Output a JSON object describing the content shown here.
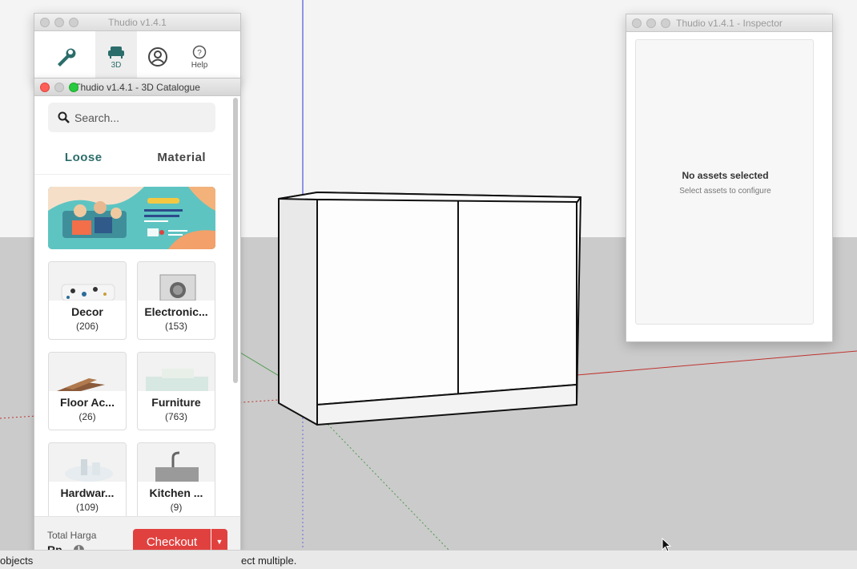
{
  "toolbar_window": {
    "title": "Thudio v1.4.1",
    "tools": [
      {
        "icon": "wrench-icon",
        "label": ""
      },
      {
        "icon": "sofa-icon",
        "label": "3D"
      },
      {
        "icon": "user-icon",
        "label": ""
      },
      {
        "icon": "help-icon",
        "label": "Help"
      }
    ]
  },
  "catalogue_window": {
    "title": "Thudio v1.4.1 - 3D Catalogue",
    "search_placeholder": "Search...",
    "tabs": [
      {
        "label": "Loose",
        "active": true
      },
      {
        "label": "Material",
        "active": false
      }
    ],
    "categories": [
      {
        "name": "Decor",
        "count": "(206)"
      },
      {
        "name": "Electronic...",
        "count": "(153)"
      },
      {
        "name": "Floor Ac...",
        "count": "(26)"
      },
      {
        "name": "Furniture",
        "count": "(763)"
      },
      {
        "name": "Hardwar...",
        "count": "(109)"
      },
      {
        "name": "Kitchen ...",
        "count": "(9)"
      }
    ],
    "footer": {
      "total_label": "Total Harga",
      "total_value": "Rp-",
      "checkout_label": "Checkout"
    }
  },
  "inspector_window": {
    "title": "Thudio v1.4.1 - Inspector",
    "empty_title": "No assets selected",
    "empty_subtitle": "Select assets to configure"
  },
  "status_bar": {
    "left_text": "objects",
    "right_text": "ect multiple."
  },
  "colors": {
    "accent": "#2b6d6b",
    "checkout": "#e0413f",
    "sky": "#f4f4f4",
    "ground": "#cbcbcb"
  }
}
